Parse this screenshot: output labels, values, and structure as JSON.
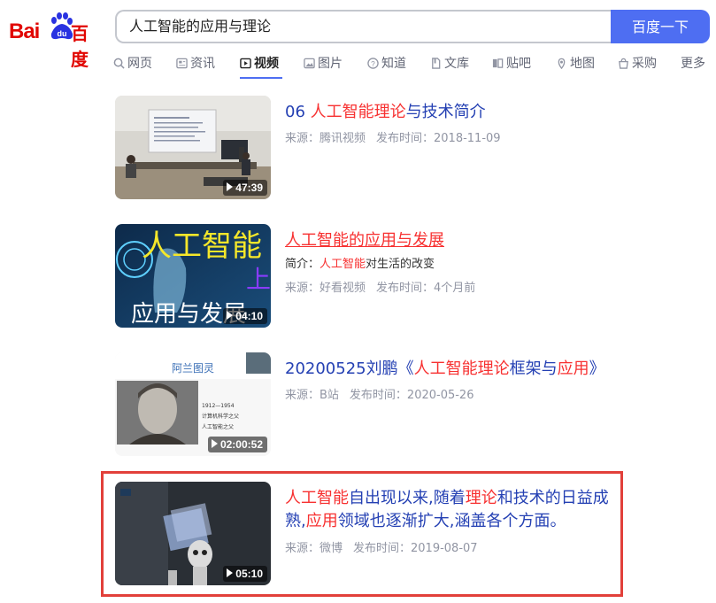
{
  "logo": {
    "bai": "Bai",
    "du": "du",
    "cn": "百度"
  },
  "search": {
    "query": "人工智能的应用与理论",
    "button": "百度一下"
  },
  "tabs": [
    {
      "label": "网页",
      "icon": "search-icon"
    },
    {
      "label": "资讯",
      "icon": "news-icon"
    },
    {
      "label": "视频",
      "icon": "video-icon",
      "active": true
    },
    {
      "label": "图片",
      "icon": "image-icon"
    },
    {
      "label": "知道",
      "icon": "question-icon"
    },
    {
      "label": "文库",
      "icon": "document-icon"
    },
    {
      "label": "贴吧",
      "icon": "tieba-icon"
    },
    {
      "label": "地图",
      "icon": "map-pin-icon"
    },
    {
      "label": "采购",
      "icon": "shopping-icon"
    },
    {
      "label": "更多",
      "icon": ""
    }
  ],
  "results": [
    {
      "title_parts": [
        "06 ",
        "人工智能理论",
        "与技术简介"
      ],
      "duration": "47:39",
      "source": "来源：腾讯视频",
      "date": "发布时间：2018-11-09"
    },
    {
      "title_parts": [
        "",
        "人工智能的应用与发展",
        ""
      ],
      "brief_prefix": "简介：",
      "brief_hl": "人工智能",
      "brief_suffix": "对生活的改变",
      "duration": "04:10",
      "thumb_text": {
        "line1": "人工智能",
        "line2": "上",
        "line3": "应用与发展"
      },
      "source": "来源：好看视频",
      "date": "发布时间：4个月前"
    },
    {
      "title_parts": [
        "20200525刘鹏《",
        "人工智能理论",
        "框架与",
        "应用",
        "》"
      ],
      "duration": "02:00:52",
      "thumb_text": {
        "header": "阿兰图灵",
        "l1": "1912—1954",
        "l2": "计算机科学之父",
        "l3": "人工智能之父"
      },
      "source": "来源：B站",
      "date": "发布时间：2020-05-26"
    },
    {
      "title_parts": [
        "人工智能",
        "自出现以来,随着",
        "理论",
        "和",
        "技术的日益成熟,",
        "应用",
        "领域也逐渐扩大,涵盖各个方面。"
      ],
      "duration": "05:10",
      "source": "来源：微博",
      "date": "发布时间：2019-08-07"
    }
  ],
  "colors": {
    "accent": "#4e6ef2",
    "link": "#2440b3",
    "highlight": "#f73131",
    "meta": "#9195a3",
    "box": "#e2403a"
  }
}
